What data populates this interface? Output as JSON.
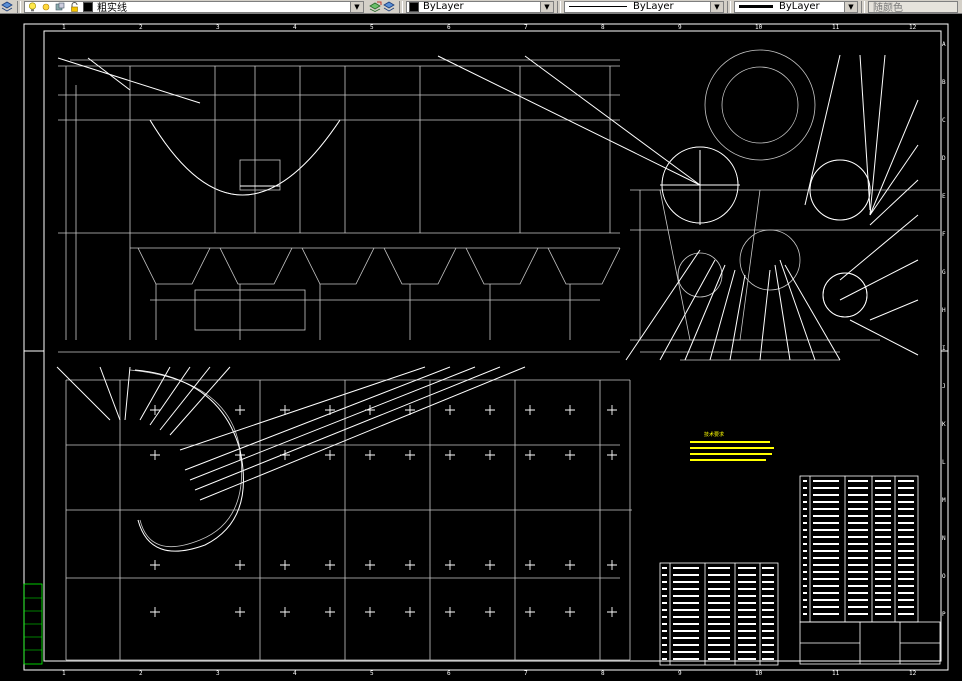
{
  "toolbar": {
    "layer_name": "粗实线",
    "color_value": "ByLayer",
    "linetype_value": "ByLayer",
    "lineweight_value": "ByLayer",
    "plotstyle_value": "随颜色"
  },
  "icons": [
    "layer-manager-icon",
    "lightbulb-icon",
    "sun-icon",
    "lock-icon",
    "color-square-icon",
    "make-current-icon",
    "layer-previous-icon"
  ],
  "drawing": {
    "border_columns": [
      "1",
      "2",
      "3",
      "4",
      "5",
      "6",
      "7",
      "8",
      "9",
      "10",
      "11",
      "12"
    ],
    "border_rows": [
      "A",
      "B",
      "C",
      "D",
      "E",
      "F",
      "G",
      "H",
      "I",
      "J",
      "K",
      "L",
      "M",
      "N",
      "O",
      "P"
    ],
    "notes_title": "技术要求",
    "accent_yellow": "#ffff00",
    "accent_green": "#00ff00",
    "line_color": "#ffffff"
  }
}
